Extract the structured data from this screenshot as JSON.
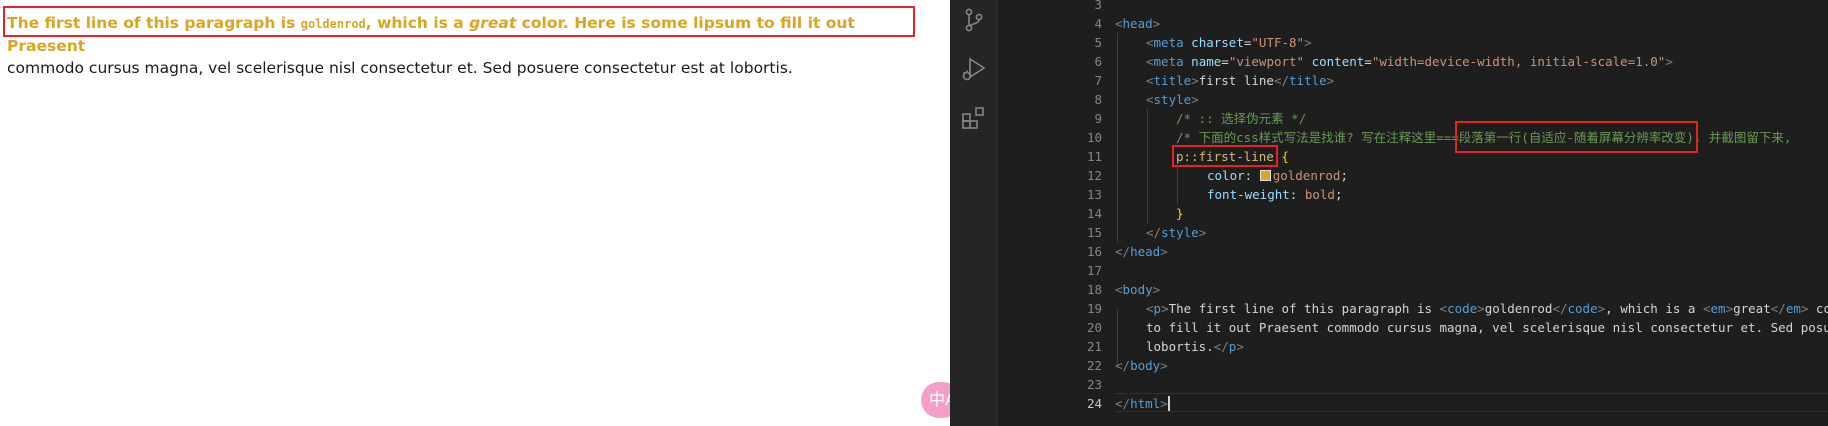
{
  "preview": {
    "line1_text_a": "The first line of this paragraph is ",
    "line1_code": "goldenrod",
    "line1_text_b": ", which is a ",
    "line1_em": "great",
    "line1_text_c": " color. Here is some lipsum to fill it out Praesent",
    "line2_text": "commodo cursus magna, vel scelerisque nisl consectetur et. Sed posuere consectetur est at lobortis.",
    "first_line_color": "#daa520",
    "translate_badge": "中A"
  },
  "activity_bar": {
    "icons": [
      "source-control-icon",
      "run-debug-icon",
      "extensions-icon"
    ]
  },
  "editor": {
    "line_numbers": [
      "3",
      "4",
      "5",
      "6",
      "7",
      "8",
      "9",
      "10",
      "11",
      "12",
      "13",
      "14",
      "15",
      "16",
      "17",
      "18",
      "19",
      "20",
      "21",
      "22",
      "23",
      "24"
    ],
    "active_line": "24",
    "code": {
      "l4": "<head>",
      "l5_tag": "meta",
      "l5_attr": "charset",
      "l5_val": "\"UTF-8\"",
      "l6_tag": "meta",
      "l6_attr1": "name",
      "l6_val1": "\"viewport\"",
      "l6_attr2": "content",
      "l6_val2": "\"width=device-width, initial-scale=1.0\"",
      "l7_text": "first line",
      "l8_tag": "style",
      "l9_comment": "/* :: 选择伪元素 */",
      "l10_comment_a": "/* 下面的css样式写法是找谁? 写在注释这里===",
      "l10_comment_b": "段落第一行(自适应-随着屏幕分辨率改变)",
      "l10_comment_c": ", 并截图留下来,",
      "l11_selector": "p::first-line",
      "l11_brace": "{",
      "l12_prop": "color",
      "l12_val": "goldenrod",
      "l13_prop": "font-weight",
      "l13_val": "bold",
      "l14_brace": "}",
      "l15_tag": "style",
      "l16_tag": "head",
      "l18_tag": "body",
      "l19_text_a": "The first line of this paragraph is ",
      "l19_code": "goldenrod",
      "l19_text_b": ", which is a ",
      "l19_em": "great",
      "l19_text_c": " col",
      "l20_text": "to fill it out Praesent commodo cursus magna, vel scelerisque nisl consectetur et. Sed posuer",
      "l21_text": "lobortis.",
      "l22_tag": "body",
      "l24_tag": "html"
    }
  }
}
